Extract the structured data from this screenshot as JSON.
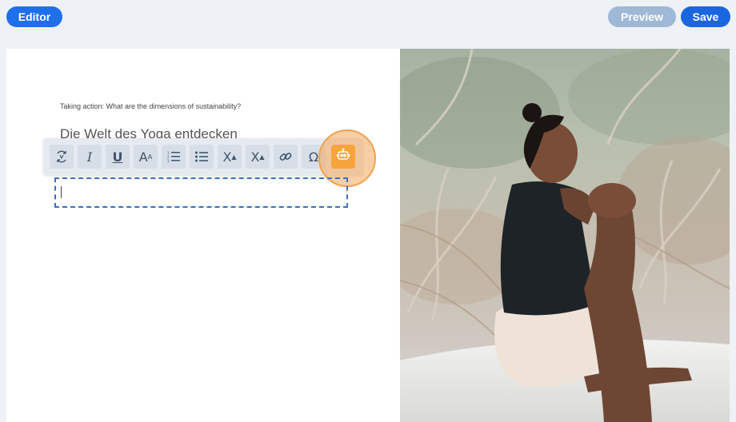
{
  "topbar": {
    "editor_label": "Editor",
    "preview_label": "Preview",
    "save_label": "Save"
  },
  "content": {
    "subtitle": "Taking action: What are the dimensions of sustainability?",
    "heading": "Die Welt des Yoga entdecken"
  },
  "toolbar": {
    "buttons": [
      {
        "icon": "ai-rewrite-icon"
      },
      {
        "icon": "italic-icon",
        "glyph": "I"
      },
      {
        "icon": "underline-icon",
        "glyph": "U"
      },
      {
        "icon": "font-size-icon",
        "glyph": "A"
      },
      {
        "icon": "ordered-list-icon"
      },
      {
        "icon": "bullet-list-icon"
      },
      {
        "icon": "superscript-icon",
        "glyph": "X"
      },
      {
        "icon": "subscript-icon",
        "glyph": "X"
      },
      {
        "icon": "link-icon"
      },
      {
        "icon": "special-character-icon",
        "glyph": "Ω"
      },
      {
        "icon": "robot-assistant-icon"
      }
    ]
  },
  "colors": {
    "primary": "#1f6feb",
    "preview_disabled": "#9fb8d6",
    "highlight": "#f6a43b",
    "dashed_border": "#3b6fb8"
  }
}
